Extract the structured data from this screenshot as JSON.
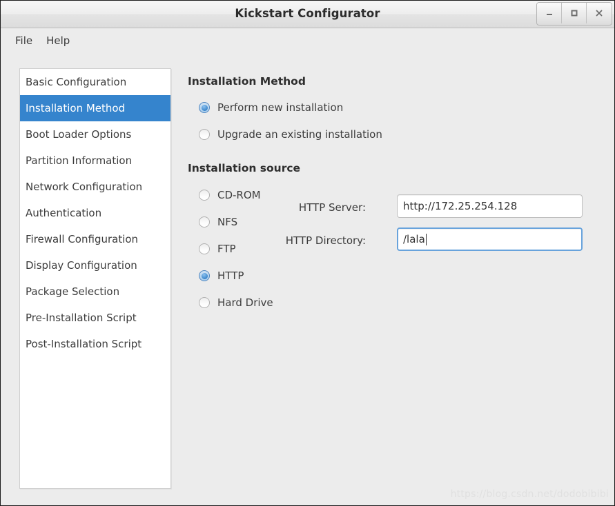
{
  "window": {
    "title": "Kickstart Configurator",
    "controls": [
      {
        "name": "minimize",
        "glyph": "minimize-icon"
      },
      {
        "name": "maximize",
        "glyph": "maximize-icon"
      },
      {
        "name": "close",
        "glyph": "close-icon"
      }
    ]
  },
  "menubar": {
    "items": [
      {
        "label": "File"
      },
      {
        "label": "Help"
      }
    ]
  },
  "sidebar": {
    "items": [
      {
        "label": "Basic Configuration",
        "selected": false
      },
      {
        "label": "Installation Method",
        "selected": true
      },
      {
        "label": "Boot Loader Options",
        "selected": false
      },
      {
        "label": "Partition Information",
        "selected": false
      },
      {
        "label": "Network Configuration",
        "selected": false
      },
      {
        "label": "Authentication",
        "selected": false
      },
      {
        "label": "Firewall Configuration",
        "selected": false
      },
      {
        "label": "Display Configuration",
        "selected": false
      },
      {
        "label": "Package Selection",
        "selected": false
      },
      {
        "label": "Pre-Installation Script",
        "selected": false
      },
      {
        "label": "Post-Installation Script",
        "selected": false
      }
    ]
  },
  "main": {
    "installation_method": {
      "title": "Installation Method",
      "options": [
        {
          "label": "Perform new installation",
          "selected": true
        },
        {
          "label": "Upgrade an existing installation",
          "selected": false
        }
      ]
    },
    "installation_source": {
      "title": "Installation source",
      "options": [
        {
          "label": "CD-ROM",
          "selected": false
        },
        {
          "label": "NFS",
          "selected": false
        },
        {
          "label": "FTP",
          "selected": false
        },
        {
          "label": "HTTP",
          "selected": true
        },
        {
          "label": "Hard Drive",
          "selected": false
        }
      ],
      "fields": [
        {
          "label": "HTTP Server:",
          "value": "http://172.25.254.128",
          "focused": false
        },
        {
          "label": "HTTP Directory:",
          "value": "/lala",
          "focused": true
        }
      ]
    }
  },
  "watermark": {
    "text": "https://blog.csdn.net/dodobibibi"
  },
  "colors": {
    "selection_blue": "#3584cd",
    "window_bg": "#ececec",
    "field_focus_border": "#68a3dc"
  }
}
